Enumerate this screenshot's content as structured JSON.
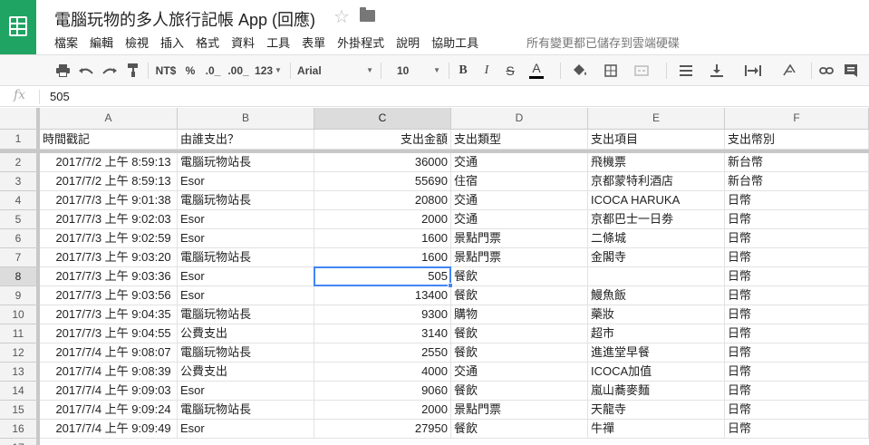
{
  "app": {
    "title": "電腦玩物的多人旅行記帳 App (回應)",
    "star_glyph": "☆",
    "save_status": "所有變更都已儲存到雲端硬碟"
  },
  "menu": [
    "檔案",
    "編輯",
    "檢視",
    "插入",
    "格式",
    "資料",
    "工具",
    "表單",
    "外掛程式",
    "說明",
    "協助工具"
  ],
  "toolbar": {
    "currency": "NT$",
    "percent": "%",
    "dec_decrease": ".0_",
    "dec_increase": ".00_",
    "more_formats": "123",
    "font": "Arial",
    "font_size": "10",
    "bold": "B",
    "italic": "I",
    "strike": "S",
    "text_color": "A",
    "text_color_hex": "#000000"
  },
  "formula_bar": {
    "fx": "fx",
    "value": "505"
  },
  "columns": [
    "A",
    "B",
    "C",
    "D",
    "E",
    "F"
  ],
  "selected": {
    "column": "C",
    "row": "8"
  },
  "header_row": [
    "時間戳記",
    "由誰支出？",
    "支出金額",
    "支出類型",
    "支出項目",
    "支出幣別"
  ],
  "rows": [
    {
      "n": "2",
      "cells": [
        "2017/7/2 上午 8:59:13",
        "電腦玩物站長",
        "36000",
        "交通",
        "飛機票",
        "新台幣"
      ]
    },
    {
      "n": "3",
      "cells": [
        "2017/7/2 上午 8:59:13",
        "Esor",
        "55690",
        "住宿",
        "京都蒙特利酒店",
        "新台幣"
      ]
    },
    {
      "n": "4",
      "cells": [
        "2017/7/3 上午 9:01:38",
        "電腦玩物站長",
        "20800",
        "交通",
        "ICOCA HARUKA",
        "日幣"
      ]
    },
    {
      "n": "5",
      "cells": [
        "2017/7/3 上午 9:02:03",
        "Esor",
        "2000",
        "交通",
        "京都巴士一日劵",
        "日幣"
      ]
    },
    {
      "n": "6",
      "cells": [
        "2017/7/3 上午 9:02:59",
        "Esor",
        "1600",
        "景點門票",
        "二條城",
        "日幣"
      ]
    },
    {
      "n": "7",
      "cells": [
        "2017/7/3 上午 9:03:20",
        "電腦玩物站長",
        "1600",
        "景點門票",
        "金閣寺",
        "日幣"
      ]
    },
    {
      "n": "8",
      "cells": [
        "2017/7/3 上午 9:03:36",
        "Esor",
        "505",
        "餐飲",
        "",
        "日幣"
      ]
    },
    {
      "n": "9",
      "cells": [
        "2017/7/3 上午 9:03:56",
        "Esor",
        "13400",
        "餐飲",
        "鰻魚飯",
        "日幣"
      ]
    },
    {
      "n": "10",
      "cells": [
        "2017/7/3 上午 9:04:35",
        "電腦玩物站長",
        "9300",
        "購物",
        "藥妝",
        "日幣"
      ]
    },
    {
      "n": "11",
      "cells": [
        "2017/7/3 上午 9:04:55",
        "公費支出",
        "3140",
        "餐飲",
        "超市",
        "日幣"
      ]
    },
    {
      "n": "12",
      "cells": [
        "2017/7/4 上午 9:08:07",
        "電腦玩物站長",
        "2550",
        "餐飲",
        "進進堂早餐",
        "日幣"
      ]
    },
    {
      "n": "13",
      "cells": [
        "2017/7/4 上午 9:08:39",
        "公費支出",
        "4000",
        "交通",
        "ICOCA加值",
        "日幣"
      ]
    },
    {
      "n": "14",
      "cells": [
        "2017/7/4 上午 9:09:03",
        "Esor",
        "9060",
        "餐飲",
        "嵐山蕎麥麵",
        "日幣"
      ]
    },
    {
      "n": "15",
      "cells": [
        "2017/7/4 上午 9:09:24",
        "電腦玩物站長",
        "2000",
        "景點門票",
        "天龍寺",
        "日幣"
      ]
    },
    {
      "n": "16",
      "cells": [
        "2017/7/4 上午 9:09:49",
        "Esor",
        "27950",
        "餐飲",
        "牛禪",
        "日幣"
      ]
    }
  ]
}
